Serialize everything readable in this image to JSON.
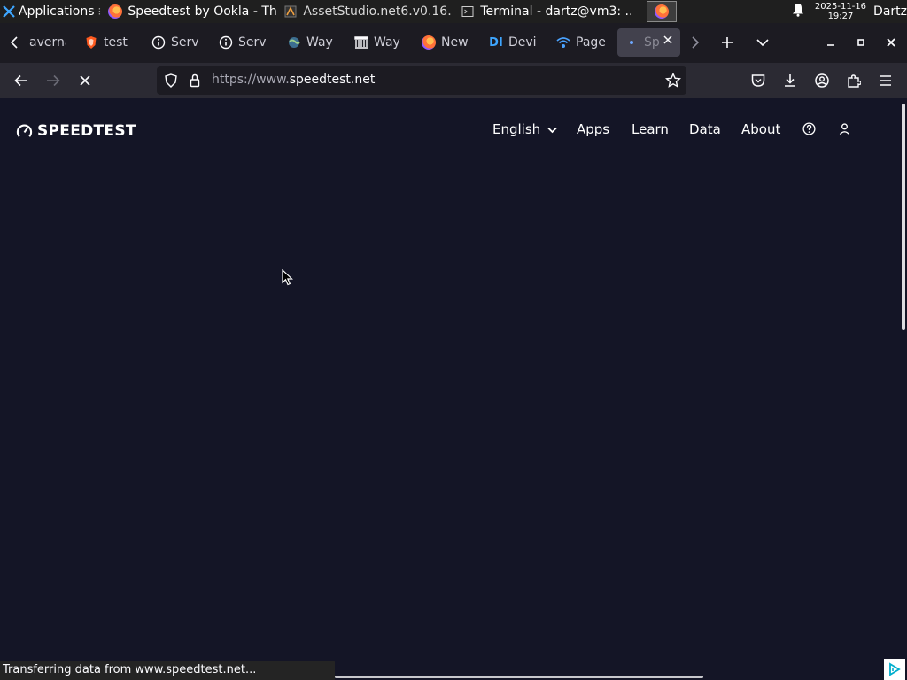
{
  "taskbar": {
    "applications_label": "Applications",
    "windows": [
      {
        "title": "Speedtest by Ookla - Th..."
      },
      {
        "title": "AssetStudio.net6.v0.16...."
      },
      {
        "title": "Terminal - dartz@vm3: ..."
      }
    ],
    "clock_date": "2025-11-16",
    "clock_time": "19:27",
    "user": "Dartz"
  },
  "tabs": [
    {
      "title": "averna"
    },
    {
      "title": "test"
    },
    {
      "title": "Serv"
    },
    {
      "title": "Serv"
    },
    {
      "title": "Way"
    },
    {
      "title": "Way"
    },
    {
      "title": "New"
    },
    {
      "title": "Devi"
    },
    {
      "title": "Page"
    },
    {
      "title": "Sp"
    }
  ],
  "tab_icons": {
    "devdocs": "DI"
  },
  "toolbar": {
    "url_scheme": "https://www.",
    "url_host": "speedtest.net"
  },
  "site": {
    "logo": "SPEEDTEST",
    "nav": {
      "language": "English",
      "apps": "Apps",
      "learn": "Learn",
      "data": "Data",
      "about": "About"
    }
  },
  "status_text": "Transferring data from www.speedtest.net...",
  "colors": {
    "page_bg": "#141526",
    "tabstrip_bg": "#1c1b22",
    "toolbar_bg": "#2b2a33",
    "active_tab_bg": "#42414d"
  }
}
